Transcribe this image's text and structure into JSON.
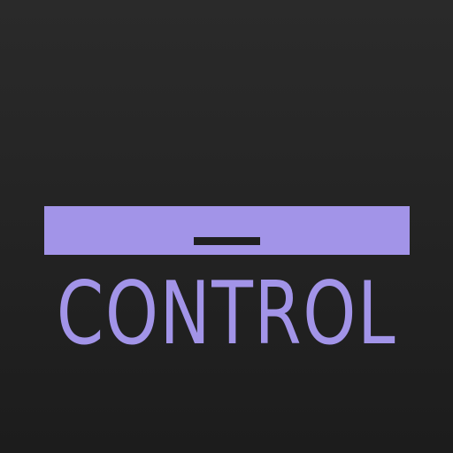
{
  "brand": {
    "wordmark": "CONTROL",
    "accent_color": "#a294e8",
    "background_color": "#242424"
  },
  "icon": {
    "name": "control-bar-icon"
  }
}
